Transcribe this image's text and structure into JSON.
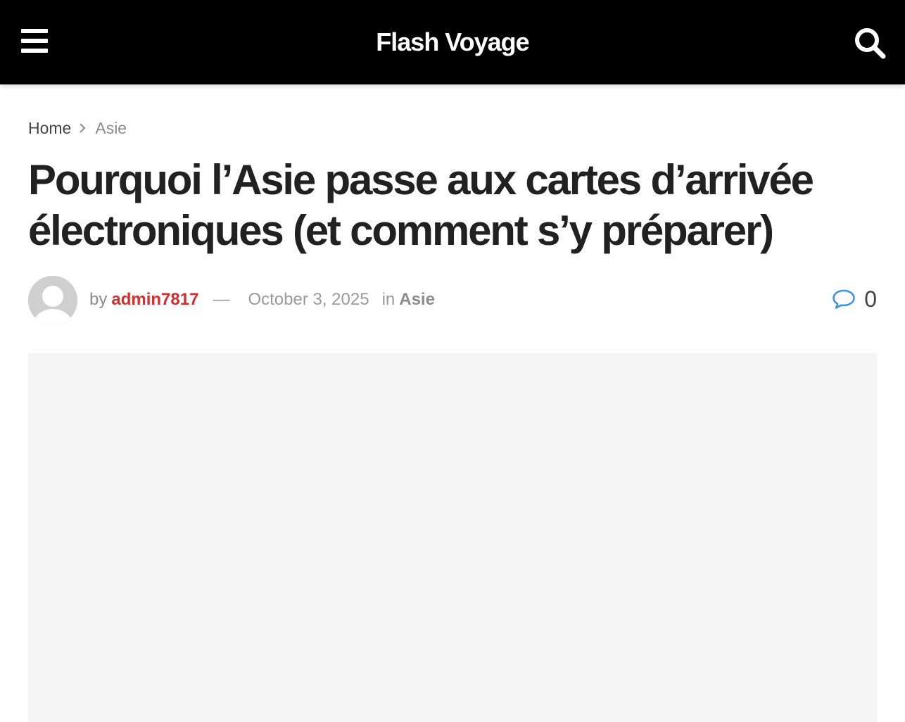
{
  "header": {
    "site_title": "Flash Voyage",
    "icons": {
      "menu": "hamburger-menu-icon",
      "search": "search-icon"
    },
    "background": "#000000"
  },
  "breadcrumb": {
    "home": "Home",
    "current": "Asie",
    "separator_icon": "chevron-right-icon"
  },
  "article": {
    "title": "Pourquoi l’Asie passe aux cartes d’arrivée électroniques (et comment s’y préparer)",
    "meta": {
      "by": "by",
      "author": "admin7817",
      "dash": "—",
      "date": "October 3, 2025",
      "in": "in",
      "category": "Asie",
      "comment_count": "0",
      "avatar_icon": "default-user-avatar-icon",
      "comment_icon": "speech-bubble-icon"
    }
  },
  "colors": {
    "author": "#d62d2d",
    "comment_icon": "#3d8fe0",
    "muted_text": "#9a9a9a",
    "image_placeholder": "#f5f5f5"
  }
}
